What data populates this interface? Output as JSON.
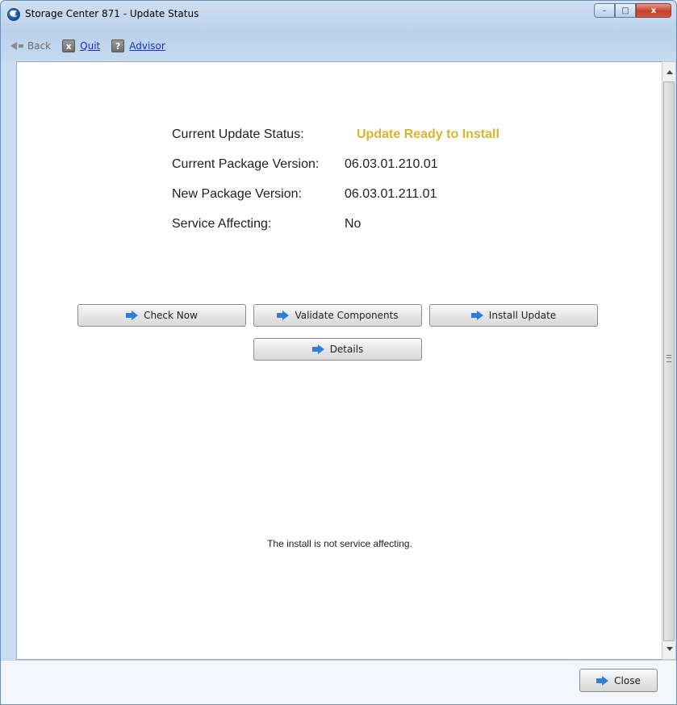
{
  "window": {
    "title": "Storage Center 871 - Update Status",
    "app_icon_letter": "C",
    "controls": {
      "minimize": "–",
      "maximize": "□",
      "close": "x"
    }
  },
  "toolbar": {
    "back_label": "Back",
    "quit_label": "Quit",
    "quit_icon": "x",
    "advisor_label": "Advisor",
    "advisor_icon": "?"
  },
  "status": {
    "current_update_status_label": "Current Update Status:",
    "current_update_status_value": "Update Ready to Install",
    "current_package_version_label": "Current Package Version:",
    "current_package_version_value": "06.03.01.210.01",
    "new_package_version_label": "New Package Version:",
    "new_package_version_value": "06.03.01.211.01",
    "service_affecting_label": "Service Affecting:",
    "service_affecting_value": "No",
    "highlight_color": "#d7b52e"
  },
  "actions": {
    "check_now": "Check Now",
    "validate_components": "Validate Components",
    "install_update": "Install Update",
    "details": "Details",
    "close": "Close"
  },
  "message": "The install is not service affecting.",
  "icons": {
    "action_arrow": "blue-arrow-right-icon"
  }
}
